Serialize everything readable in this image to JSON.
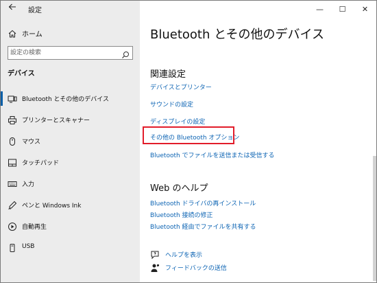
{
  "window": {
    "title": "設定",
    "controls": {
      "minimize": "—",
      "maximize": "☐",
      "close": "✕"
    }
  },
  "sidebar": {
    "home_label": "ホーム",
    "search_placeholder": "設定の検索",
    "section_heading": "デバイス",
    "items": [
      {
        "label": "Bluetooth とその他のデバイス",
        "icon": "bluetooth-devices-icon",
        "selected": true
      },
      {
        "label": "プリンターとスキャナー",
        "icon": "printer-icon",
        "selected": false
      },
      {
        "label": "マウス",
        "icon": "mouse-icon",
        "selected": false
      },
      {
        "label": "タッチパッド",
        "icon": "touchpad-icon",
        "selected": false
      },
      {
        "label": "入力",
        "icon": "keyboard-icon",
        "selected": false
      },
      {
        "label": "ペンと Windows Ink",
        "icon": "pen-icon",
        "selected": false
      },
      {
        "label": "自動再生",
        "icon": "autoplay-icon",
        "selected": false
      },
      {
        "label": "USB",
        "icon": "usb-icon",
        "selected": false
      }
    ]
  },
  "main": {
    "page_title": "Bluetooth とその他のデバイス",
    "related": {
      "heading": "関連設定",
      "links": [
        "デバイスとプリンター",
        "サウンドの設定",
        "ディスプレイの設定",
        "その他の Bluetooth オプション",
        "Bluetooth でファイルを送信または受信する"
      ]
    },
    "web_help": {
      "heading": "Web のヘルプ",
      "links": [
        "Bluetooth ドライバの再インストール",
        "Bluetooth 接続の修正",
        "Bluetooth 経由でファイルを共有する"
      ]
    },
    "help": {
      "get_help": "ヘルプを表示",
      "feedback": "フィードバックの送信"
    }
  },
  "colors": {
    "sidebar_bg": "#ececec",
    "link": "#0b63b3",
    "selection_accent": "#0a5fa8",
    "highlight_border": "#e21c2a"
  }
}
